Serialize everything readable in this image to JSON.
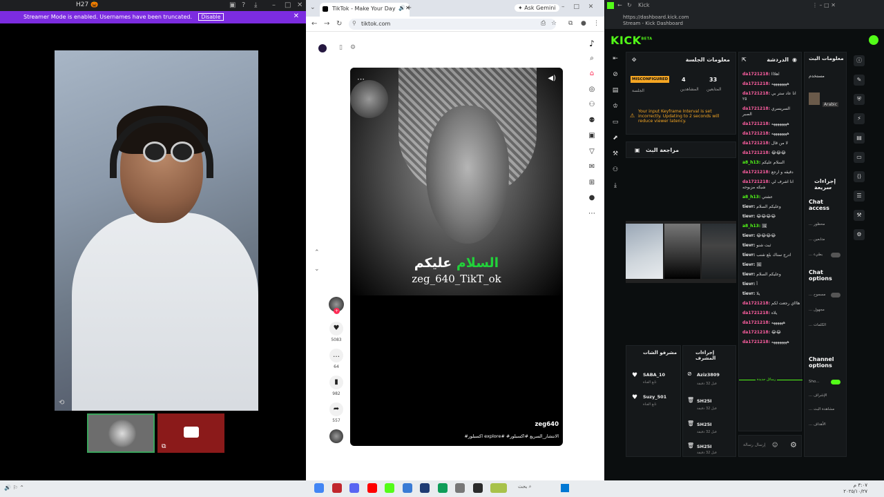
{
  "left": {
    "tab_title": "H27 🎃",
    "banner_text": "Streamer Mode is enabled. Usernames have been truncated.",
    "banner_button": "Disable"
  },
  "browser": {
    "tab_title": "TikTok - Make Your Day",
    "ask_gemini": "Ask Gemini",
    "url": "tiktok.com"
  },
  "tiktok": {
    "caption_green": "السلام",
    "caption_white": "عليكم",
    "caption_line2": "zeg_640_TikT_ok",
    "username": "zeg640",
    "hashtags": "#اكسبلور explore# #الانتشار_السريع #اكسبلور",
    "likes": "5083",
    "comments": "64",
    "saves": "982",
    "shares": "557"
  },
  "kick": {
    "tab_title": "Kick",
    "url": "https://dashboard.kick.com",
    "url_sub": "Stream - Kick Dashboard",
    "logo": "KICK",
    "logo_sup": "BETA",
    "session": {
      "title": "معلومات الجلسة",
      "badge": "MISCONFIGURED",
      "badge_label": "الجلسة",
      "viewers_value": "4",
      "viewers_label": "المشاهدين",
      "followers_value": "33",
      "followers_label": "المتابعين"
    },
    "warning": "Your input Keyframe Interval is set incorrectly. Updating to 2 seconds will reduce viewer latency.",
    "review_title": "مراجعة البث",
    "chat_title": "الدردشة",
    "chat_messages": [
      {
        "user": "da1721218:",
        "text": "اهلااا",
        "c": "p"
      },
      {
        "user": "da1721218:",
        "text": "ههههههههه",
        "c": "p"
      },
      {
        "user": "da1721218:",
        "text": "انا عاد ستر بي ٢٥",
        "c": "p"
      },
      {
        "user": "da1721218:",
        "text": "السريسري الصبر",
        "c": "p"
      },
      {
        "user": "da1721218:",
        "text": "ههههههههه",
        "c": "p"
      },
      {
        "user": "da1721218:",
        "text": "ههههههههه",
        "c": "p"
      },
      {
        "user": "da1721218:",
        "text": "لا من قال",
        "c": "p"
      },
      {
        "user": "da1721218:",
        "text": "😂😂😂",
        "c": "p"
      },
      {
        "user": "a8_h13:",
        "text": "السلام عليكم",
        "c": "g"
      },
      {
        "user": "da1721218:",
        "text": "دقيقه و ارجع",
        "c": "p"
      },
      {
        "user": "da1721218:",
        "text": "انا اشرف لي شبكه مزبوحه",
        "c": "p"
      },
      {
        "user": "a8_h13:",
        "text": "عشتي",
        "c": "g"
      },
      {
        "user": "tievr:",
        "text": "وعليكم السلام",
        "c": "b"
      },
      {
        "user": "tievr:",
        "text": "😂😂😂😂",
        "c": "b"
      },
      {
        "user": "a8_h13:",
        "text": "🖼",
        "c": "g"
      },
      {
        "user": "tievr:",
        "text": "😂😂😂😂",
        "c": "b"
      },
      {
        "user": "tievr:",
        "text": "ثبت شنو",
        "c": "b"
      },
      {
        "user": "tievr:",
        "text": "ادرج سناك بلع شنب",
        "c": "b"
      },
      {
        "user": "tievr:",
        "text": "🖼",
        "c": "b"
      },
      {
        "user": "tievr:",
        "text": "وعليكم السلام",
        "c": "b"
      },
      {
        "user": "tievr:",
        "text": "أ",
        "c": "b"
      },
      {
        "user": "tievr:",
        "text": "يلا",
        "c": "b"
      },
      {
        "user": "da1721218:",
        "text": "هاااي رجعت لكم",
        "c": "p"
      },
      {
        "user": "da1721218:",
        "text": "يلاه",
        "c": "p"
      },
      {
        "user": "da1721218:",
        "text": "ههههههه",
        "c": "p"
      },
      {
        "user": "da1721218:",
        "text": "😂😂",
        "c": "p"
      },
      {
        "user": "da1721218:",
        "text": "ههههههههه",
        "c": "p"
      }
    ],
    "new_messages_label": "رسائل جديدة",
    "chat_input_placeholder": "إرسال رسالة",
    "mod_title": "معلومات البث",
    "mod_user": "مستخدم",
    "mod_lang": "Arabic",
    "quick_actions_title": "إجراءات سريعة",
    "chat_access": "Chat access",
    "chat_options": "Chat options",
    "channel_options": "Channel options",
    "show_label": "Sho...",
    "access_rows": [
      "... محظور",
      "... متابعين",
      "... بطيء"
    ],
    "option_rows": [
      "... مسموح",
      "... مجهول",
      "... الكلمات"
    ],
    "channel_rows": [
      "... الإشراف",
      "... مشاهدة البث",
      "... الأهداف"
    ],
    "modlist_title": "مشرفو الشات",
    "modlist_items": [
      {
        "name": "SABA_10",
        "sub": "تابع القناة"
      },
      {
        "name": "Suzy_501",
        "sub": "تابع القناة"
      }
    ],
    "modacts_title": "إجراءات المشرف",
    "modacts_items": [
      {
        "name": "Aziz3809",
        "sub": "قبل 32 دقيقة"
      },
      {
        "name": "SH25I",
        "sub": "قبل 32 دقيقة"
      },
      {
        "name": "SH25I",
        "sub": "قبل 32 دقيقة"
      },
      {
        "name": "SH25I",
        "sub": "قبل 32 دقيقة"
      }
    ]
  },
  "taskbar": {
    "search": "بحث",
    "time": "٣:٠٧ م",
    "date": "٢٠٢٥/١٠/٢٧"
  }
}
